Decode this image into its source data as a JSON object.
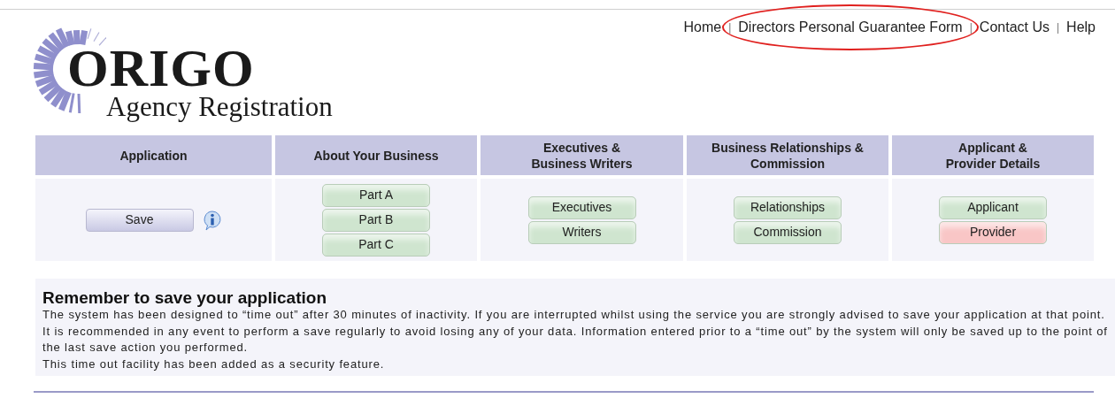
{
  "logo": {
    "title": "ORIGO",
    "subtitle": "Agency Registration"
  },
  "nav": [
    {
      "label": "Home",
      "highlighted": false
    },
    {
      "label": "Directors Personal Guarantee Form",
      "highlighted": true
    },
    {
      "label": "Contact Us",
      "highlighted": false
    },
    {
      "label": "Help",
      "highlighted": false
    }
  ],
  "nav_separator": "|",
  "sections": [
    {
      "title": [
        "Application"
      ],
      "buttons": [
        {
          "label": "Save",
          "kind": "save"
        }
      ],
      "info": true
    },
    {
      "title": [
        "About Your Business"
      ],
      "buttons": [
        {
          "label": "Part A",
          "kind": "step",
          "color": "#cfe5cf"
        },
        {
          "label": "Part B",
          "kind": "step",
          "color": "#cfe5cf"
        },
        {
          "label": "Part C",
          "kind": "step",
          "color": "#cfe5cf"
        }
      ],
      "info": false
    },
    {
      "title": [
        "Executives &",
        "Business Writers"
      ],
      "buttons": [
        {
          "label": "Executives",
          "kind": "step",
          "color": "#cfe5cf"
        },
        {
          "label": "Writers",
          "kind": "step",
          "color": "#cfe5cf"
        }
      ],
      "info": false
    },
    {
      "title": [
        "Business Relationships &",
        "Commission"
      ],
      "buttons": [
        {
          "label": "Relationships",
          "kind": "step",
          "color": "#cfe5cf"
        },
        {
          "label": "Commission",
          "kind": "step",
          "color": "#cfe5cf"
        }
      ],
      "info": false
    },
    {
      "title": [
        "Applicant &",
        "Provider Details"
      ],
      "buttons": [
        {
          "label": "Applicant",
          "kind": "step",
          "color": "#cfe5cf"
        },
        {
          "label": "Provider",
          "kind": "step",
          "color": "#f9c6c6"
        }
      ],
      "info": false
    }
  ],
  "notice": {
    "heading": "Remember to save your application",
    "paragraphs": [
      "The system has been designed to “time out” after 30 minutes of inactivity. If you are interrupted whilst using the service you are strongly advised to save your application at that point.",
      "It is recommended in any event to perform a save regularly to avoid losing any of your data. Information entered prior to a “time out” by the system will only be saved up to the point of the last save action you performed.",
      "This time out facility has been added as a security feature."
    ]
  }
}
